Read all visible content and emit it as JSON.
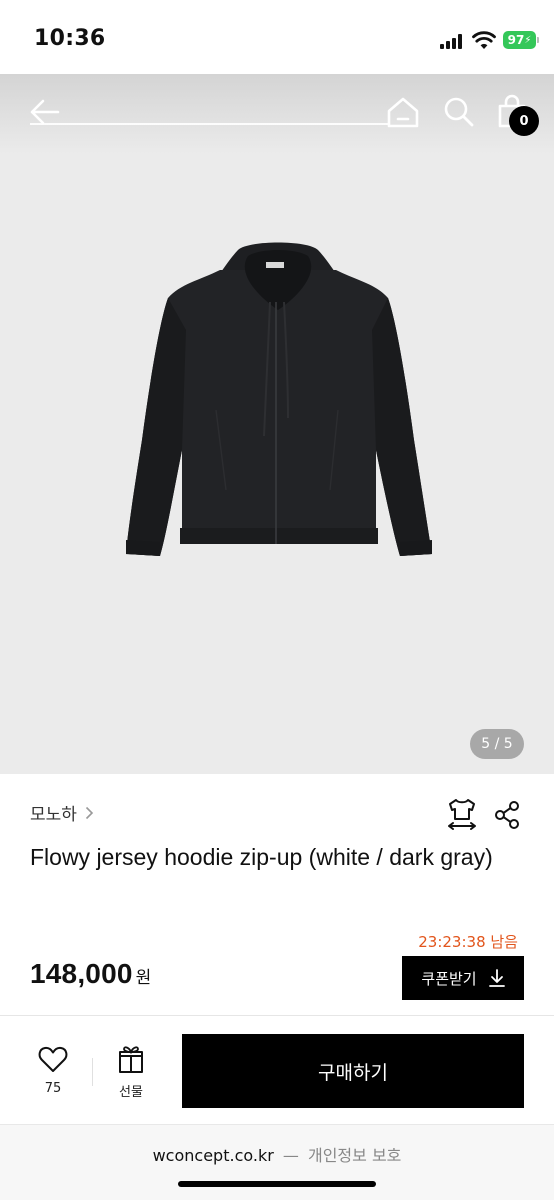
{
  "status_bar": {
    "time": "10:36",
    "battery": "97"
  },
  "nav": {
    "cart_count": "0"
  },
  "gallery": {
    "page_indicator": "5 / 5"
  },
  "product": {
    "brand": "모노하",
    "title": "Flowy jersey hoodie zip-up (white / dark gray)",
    "timer": "23:23:38 남음",
    "price": "148,000",
    "price_unit": "원",
    "coupon_label": "쿠폰받기"
  },
  "bottom_bar": {
    "like_count": "75",
    "gift_label": "선물",
    "buy_label": "구매하기"
  },
  "browser": {
    "url": "wconcept.co.kr",
    "separator": "—",
    "privacy": "개인정보 보호"
  },
  "colors": {
    "accent": "#e2551c",
    "primary_button": "#000000",
    "image_background": "#ebebeb",
    "battery": "#34c759"
  }
}
